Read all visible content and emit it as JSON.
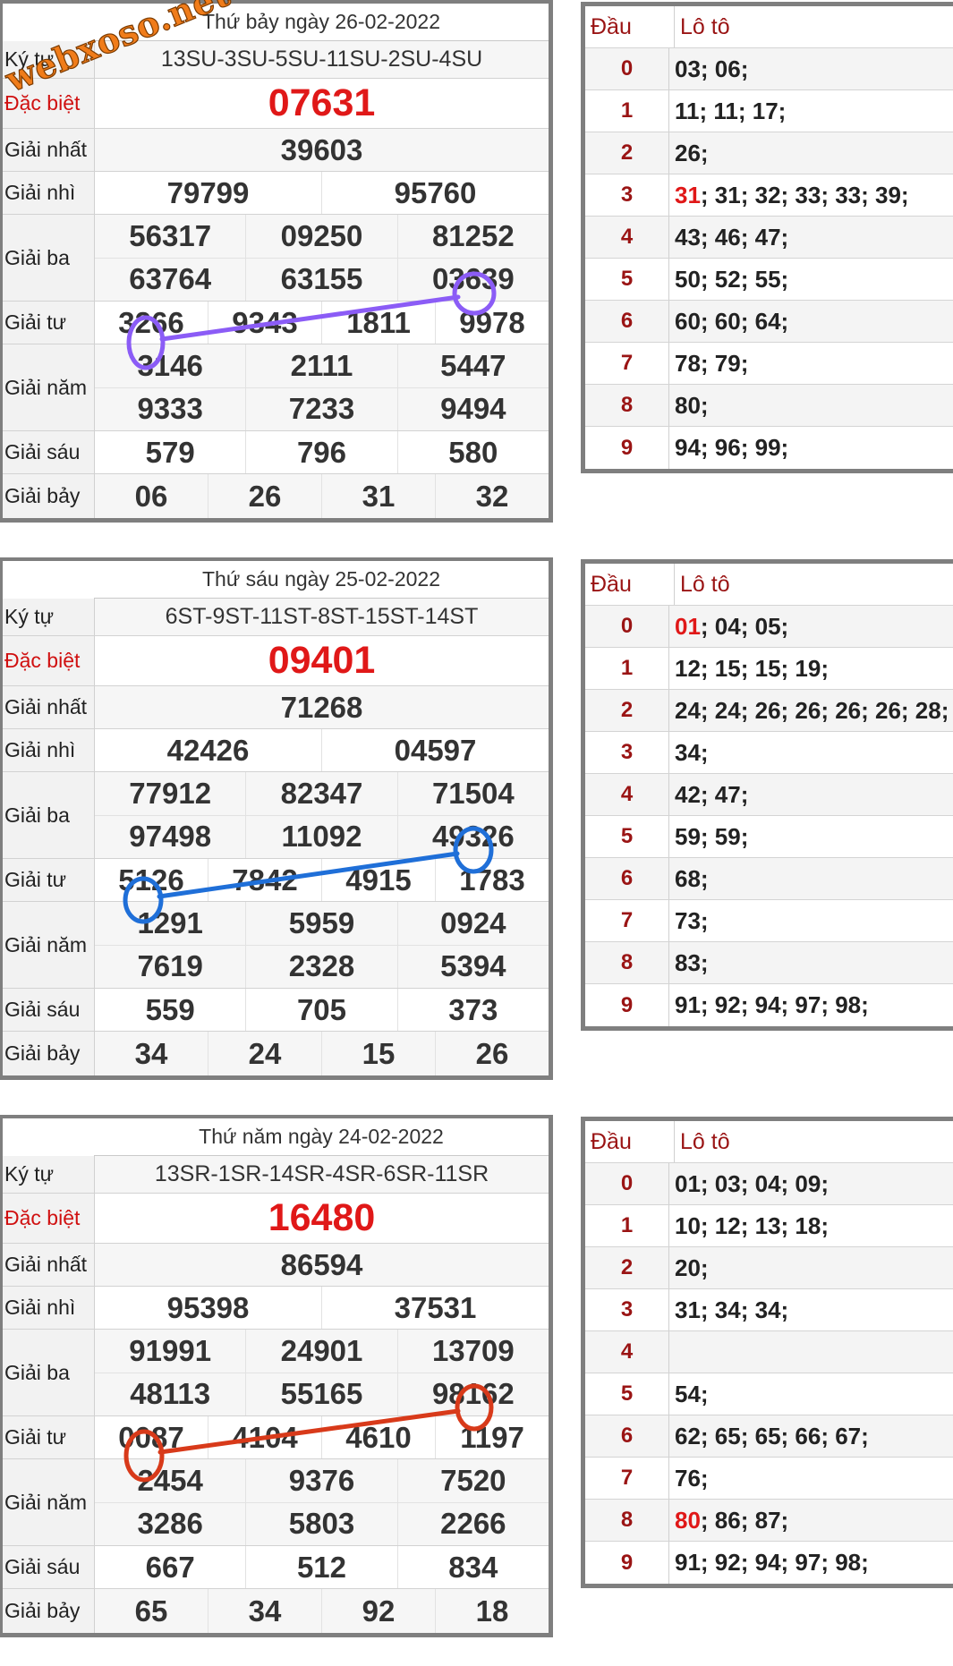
{
  "watermark": "webxoso.net",
  "labels": {
    "ky_tu": "Ký tự",
    "dac_biet": "Đặc biệt",
    "giai_nhat": "Giải nhất",
    "giai_nhi": "Giải nhì",
    "giai_ba": "Giải ba",
    "giai_tu": "Giải tư",
    "giai_nam": "Giải năm",
    "giai_sau": "Giải sáu",
    "giai_bay": "Giải bảy",
    "dau": "Đầu",
    "loto": "Lô tô"
  },
  "colors": {
    "mark_1": "#8b5cf6",
    "mark_2": "#1f6fd8",
    "mark_3": "#d83a1a",
    "special": "#e01818"
  },
  "results": [
    {
      "date": "Thứ bảy ngày 26-02-2022",
      "ky_tu": "13SU-3SU-5SU-11SU-2SU-4SU",
      "dac_biet": "07631",
      "giai_nhat": "39603",
      "giai_nhi": [
        "79799",
        "95760"
      ],
      "giai_ba": [
        "56317",
        "09250",
        "81252",
        "63764",
        "63155",
        "03639"
      ],
      "giai_tu": [
        "3266",
        "9343",
        "1811",
        "9978"
      ],
      "giai_nam": [
        "3146",
        "2111",
        "5447",
        "9333",
        "7233",
        "9494"
      ],
      "giai_sau": [
        "579",
        "796",
        "580"
      ],
      "giai_bay": [
        "06",
        "26",
        "31",
        "32"
      ],
      "loto": [
        {
          "dau": "0",
          "hl": "",
          "rest": "03; 06;"
        },
        {
          "dau": "1",
          "hl": "",
          "rest": "11; 11; 17;"
        },
        {
          "dau": "2",
          "hl": "",
          "rest": "26;"
        },
        {
          "dau": "3",
          "hl": "31",
          "rest": "; 31; 32; 33; 33; 39;"
        },
        {
          "dau": "4",
          "hl": "",
          "rest": "43; 46; 47;"
        },
        {
          "dau": "5",
          "hl": "",
          "rest": "50; 52; 55;"
        },
        {
          "dau": "6",
          "hl": "",
          "rest": "60; 60; 64;"
        },
        {
          "dau": "7",
          "hl": "",
          "rest": "78; 79;"
        },
        {
          "dau": "8",
          "hl": "",
          "rest": "80;"
        },
        {
          "dau": "9",
          "hl": "",
          "rest": "94; 96; 99;"
        }
      ]
    },
    {
      "date": "Thứ sáu ngày 25-02-2022",
      "ky_tu": "6ST-9ST-11ST-8ST-15ST-14ST",
      "dac_biet": "09401",
      "giai_nhat": "71268",
      "giai_nhi": [
        "42426",
        "04597"
      ],
      "giai_ba": [
        "77912",
        "82347",
        "71504",
        "97498",
        "11092",
        "49326"
      ],
      "giai_tu": [
        "5126",
        "7842",
        "4915",
        "1783"
      ],
      "giai_nam": [
        "1291",
        "5959",
        "0924",
        "7619",
        "2328",
        "5394"
      ],
      "giai_sau": [
        "559",
        "705",
        "373"
      ],
      "giai_bay": [
        "34",
        "24",
        "15",
        "26"
      ],
      "loto": [
        {
          "dau": "0",
          "hl": "01",
          "rest": "; 04; 05;"
        },
        {
          "dau": "1",
          "hl": "",
          "rest": "12; 15; 15; 19;"
        },
        {
          "dau": "2",
          "hl": "",
          "rest": "24; 24; 26; 26; 26; 26; 28;"
        },
        {
          "dau": "3",
          "hl": "",
          "rest": "34;"
        },
        {
          "dau": "4",
          "hl": "",
          "rest": "42; 47;"
        },
        {
          "dau": "5",
          "hl": "",
          "rest": "59; 59;"
        },
        {
          "dau": "6",
          "hl": "",
          "rest": "68;"
        },
        {
          "dau": "7",
          "hl": "",
          "rest": "73;"
        },
        {
          "dau": "8",
          "hl": "",
          "rest": "83;"
        },
        {
          "dau": "9",
          "hl": "",
          "rest": "91; 92; 94; 97; 98;"
        }
      ]
    },
    {
      "date": "Thứ năm ngày 24-02-2022",
      "ky_tu": "13SR-1SR-14SR-4SR-6SR-11SR",
      "dac_biet": "16480",
      "giai_nhat": "86594",
      "giai_nhi": [
        "95398",
        "37531"
      ],
      "giai_ba": [
        "91991",
        "24901",
        "13709",
        "48113",
        "55165",
        "98162"
      ],
      "giai_tu": [
        "0087",
        "4104",
        "4610",
        "1197"
      ],
      "giai_nam": [
        "2454",
        "9376",
        "7520",
        "3286",
        "5803",
        "2266"
      ],
      "giai_sau": [
        "667",
        "512",
        "834"
      ],
      "giai_bay": [
        "65",
        "34",
        "92",
        "18"
      ],
      "loto": [
        {
          "dau": "0",
          "hl": "",
          "rest": "01; 03; 04; 09;"
        },
        {
          "dau": "1",
          "hl": "",
          "rest": "10; 12; 13; 18;"
        },
        {
          "dau": "2",
          "hl": "",
          "rest": "20;"
        },
        {
          "dau": "3",
          "hl": "",
          "rest": "31; 34; 34;"
        },
        {
          "dau": "4",
          "hl": "",
          "rest": ""
        },
        {
          "dau": "5",
          "hl": "",
          "rest": "54;"
        },
        {
          "dau": "6",
          "hl": "",
          "rest": "62; 65; 65; 66; 67;"
        },
        {
          "dau": "7",
          "hl": "",
          "rest": "76;"
        },
        {
          "dau": "8",
          "hl": "80",
          "rest": "; 86; 87;"
        },
        {
          "dau": "9",
          "hl": "",
          "rest": "91; 92; 94; 97; 98;"
        }
      ]
    }
  ]
}
